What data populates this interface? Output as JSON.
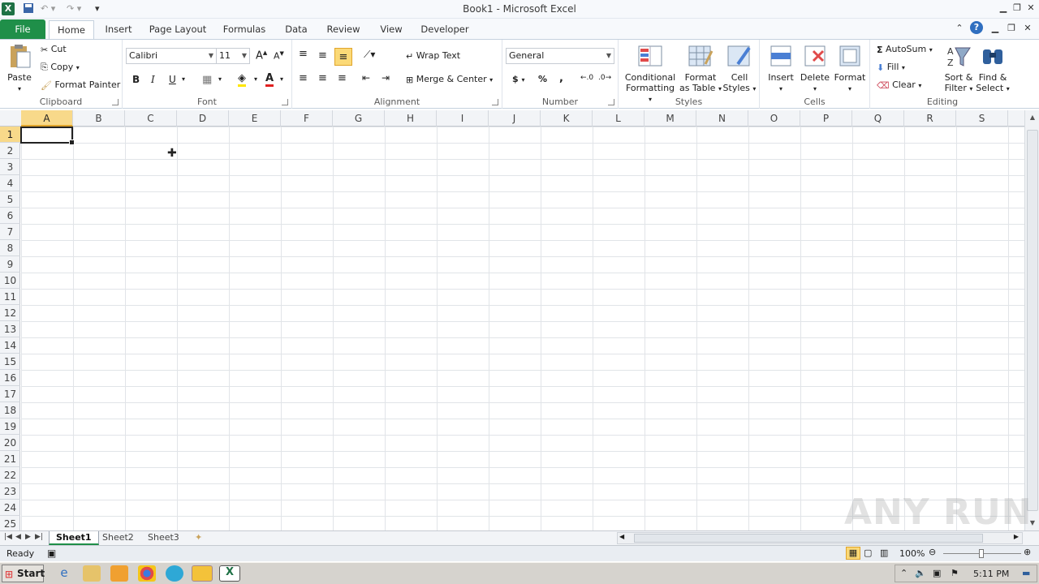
{
  "window": {
    "title": "Book1 - Microsoft Excel",
    "logo": "X"
  },
  "tabs": [
    "File",
    "Home",
    "Insert",
    "Page Layout",
    "Formulas",
    "Data",
    "Review",
    "View",
    "Developer"
  ],
  "clipboard": {
    "label": "Clipboard",
    "paste": "Paste",
    "cut": "Cut",
    "copy": "Copy",
    "format_painter": "Format Painter"
  },
  "font": {
    "label": "Font",
    "name": "Calibri",
    "size": "11",
    "bold": "B",
    "italic": "I",
    "underline": "U"
  },
  "alignment": {
    "label": "Alignment",
    "wrap": "Wrap Text",
    "merge": "Merge & Center"
  },
  "number": {
    "label": "Number",
    "format": "General",
    "currency": "$",
    "percent": "%",
    "comma": ","
  },
  "styles": {
    "label": "Styles",
    "conditional": "Conditional",
    "conditional2": "Formatting",
    "format_table": "Format",
    "format_table2": "as Table",
    "cell_styles": "Cell",
    "cell_styles2": "Styles"
  },
  "cells": {
    "label": "Cells",
    "insert": "Insert",
    "delete": "Delete",
    "format": "Format"
  },
  "editing": {
    "label": "Editing",
    "autosum": "AutoSum",
    "fill": "Fill",
    "clear": "Clear",
    "sort": "Sort &",
    "sort2": "Filter",
    "find": "Find &",
    "find2": "Select"
  },
  "columns": [
    "A",
    "B",
    "C",
    "D",
    "E",
    "F",
    "G",
    "H",
    "I",
    "J",
    "K",
    "L",
    "M",
    "N",
    "O",
    "P",
    "Q",
    "R",
    "S"
  ],
  "rows": [
    "1",
    "2",
    "3",
    "4",
    "5",
    "6",
    "7",
    "8",
    "9",
    "10",
    "11",
    "12",
    "13",
    "14",
    "15",
    "16",
    "17",
    "18",
    "19",
    "20",
    "21",
    "22",
    "23",
    "24",
    "25"
  ],
  "sheets": [
    "Sheet1",
    "Sheet2",
    "Sheet3"
  ],
  "status": {
    "text": "Ready",
    "zoom": "100%"
  },
  "taskbar": {
    "start": "Start",
    "time": "5:11 PM"
  },
  "watermark": "ANY RUN",
  "colors": {
    "file_tab": "#1f8f49",
    "selection_header": "#f8d98a"
  }
}
